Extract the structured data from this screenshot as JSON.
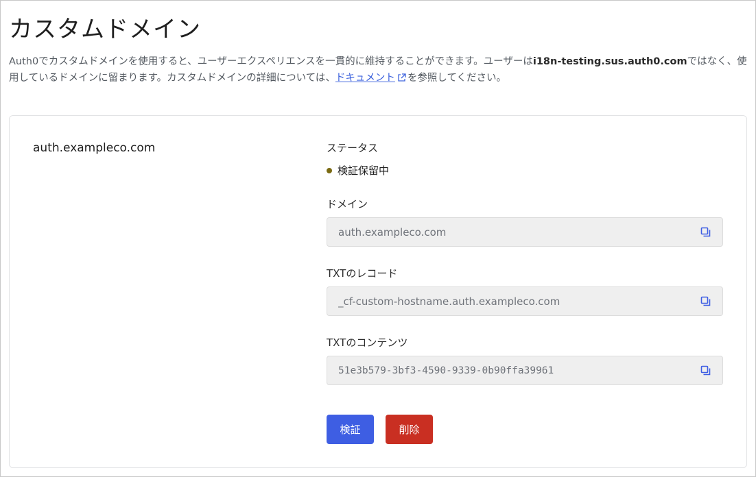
{
  "page": {
    "title": "カスタムドメイン",
    "description": {
      "part1": "Auth0でカスタムドメインを使用すると、ユーザーエクスペリエンスを一貫的に維持することができます。ユーザーは",
      "tenant_domain": "i18n-testing.sus.auth0.com",
      "part2": "ではなく、使用しているドメインに留まります。カスタムドメインの詳細については、",
      "link_label": "ドキュメント",
      "part3": "を参照してください。"
    }
  },
  "domain_card": {
    "domain_name": "auth.exampleco.com",
    "status_label": "ステータス",
    "status_value": "検証保留中",
    "status_color": "#7a6a12",
    "domain_label": "ドメイン",
    "domain_value": "auth.exampleco.com",
    "txt_record_label": "TXTのレコード",
    "txt_record_value": "_cf-custom-hostname.auth.exampleco.com",
    "txt_content_label": "TXTのコンテンツ",
    "txt_content_value": "51e3b579-3bf3-4590-9339-0b90ffa39961",
    "verify_button": "検証",
    "delete_button": "削除",
    "verify_color": "#3e5ee3",
    "delete_color": "#c92f22"
  },
  "icons": {
    "copy": "copy-icon",
    "external_link": "external-link-icon"
  }
}
